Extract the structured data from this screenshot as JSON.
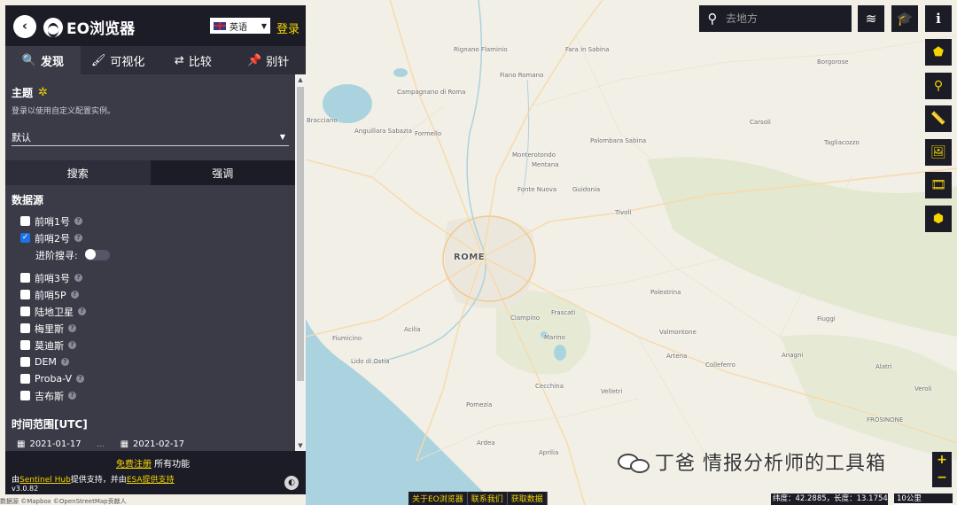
{
  "app": {
    "logo_text": "EO浏览器",
    "back_glyph": "‹",
    "language": "英语",
    "login": "登录"
  },
  "tabs": [
    {
      "label": "发现",
      "icon": "🔍",
      "active": true
    },
    {
      "label": "可视化",
      "icon": "🖌",
      "active": false
    },
    {
      "label": "比较",
      "icon": "⇄",
      "active": false
    },
    {
      "label": "别针",
      "icon": "📌",
      "active": false
    }
  ],
  "theme": {
    "title": "主题",
    "hint": "登录以使用自定义配置实例。",
    "selected": "默认"
  },
  "subtabs": {
    "search": "搜索",
    "highlight": "强调"
  },
  "datasource": {
    "title": "数据源",
    "items": [
      {
        "label": "前哨1号",
        "checked": false
      },
      {
        "label": "前哨2号",
        "checked": true
      },
      {
        "label": "前哨3号",
        "checked": false
      },
      {
        "label": "前哨5P",
        "checked": false
      },
      {
        "label": "陆地卫星",
        "checked": false
      },
      {
        "label": "梅里斯",
        "checked": false
      },
      {
        "label": "莫迪斯",
        "checked": false
      },
      {
        "label": "DEM",
        "checked": false
      },
      {
        "label": "Proba-V",
        "checked": false
      },
      {
        "label": "吉布斯",
        "checked": false
      }
    ],
    "advanced_label": "进阶搜寻:"
  },
  "time_range": {
    "title": "时间范围[UTC]",
    "from": "2021-01-17",
    "to": "2021-02-17",
    "separator": "..."
  },
  "footer": {
    "signup_link": "免费注册",
    "signup_rest": " 所有功能",
    "powered_prefix": "由",
    "sentinel_hub": "Sentinel Hub",
    "powered_mid": "提供支持，并由",
    "esa_link": "ESA提供支持",
    "version": "v3.0.82"
  },
  "search": {
    "placeholder": "去地方"
  },
  "bottom_links": [
    "关于EO浏览器",
    "联系我们",
    "获取数据"
  ],
  "coords": "纬度：42.2885，长度：13.1754",
  "scale": "10公里",
  "attribution": "数据源 ©Mapbox ©OpenStreetMap贡献人",
  "watermark": "丁爸 情报分析师的工具箱",
  "places": [
    {
      "name": "Rignano Flaminio"
    },
    {
      "name": "Fara in Sabina"
    },
    {
      "name": "Borgorose"
    },
    {
      "name": "Fiano Romano"
    },
    {
      "name": "Campagnano di Roma"
    },
    {
      "name": "Bracciano"
    },
    {
      "name": "Carsoli"
    },
    {
      "name": "Anguillara Sabazia"
    },
    {
      "name": "Formello"
    },
    {
      "name": "Palombara Sabina"
    },
    {
      "name": "Tagliacozzo"
    },
    {
      "name": "Monterotondo"
    },
    {
      "name": "Mentana"
    },
    {
      "name": "Fonte Nuova"
    },
    {
      "name": "Guidonia"
    },
    {
      "name": "Tivoli"
    },
    {
      "name": "ROME"
    },
    {
      "name": "Palestrina"
    },
    {
      "name": "Ciampino"
    },
    {
      "name": "Frascati"
    },
    {
      "name": "Marino"
    },
    {
      "name": "Fiumicino"
    },
    {
      "name": "Acilia"
    },
    {
      "name": "Valmontone"
    },
    {
      "name": "Fiuggi"
    },
    {
      "name": "Lido di Ostia"
    },
    {
      "name": "Artena"
    },
    {
      "name": "Colleferro"
    },
    {
      "name": "Anagni"
    },
    {
      "name": "Alatri"
    },
    {
      "name": "Cecchina"
    },
    {
      "name": "Velletri"
    },
    {
      "name": "Veroli"
    },
    {
      "name": "Pomezia"
    },
    {
      "name": "FROSINONE"
    },
    {
      "name": "Ardea"
    },
    {
      "name": "Aprilia"
    }
  ],
  "colors": {
    "panel_bg": "#3b3b48",
    "header_bg": "#1c1c26",
    "accent": "#f5d400",
    "sea": "#aad3df",
    "land": "#f2efe6"
  }
}
